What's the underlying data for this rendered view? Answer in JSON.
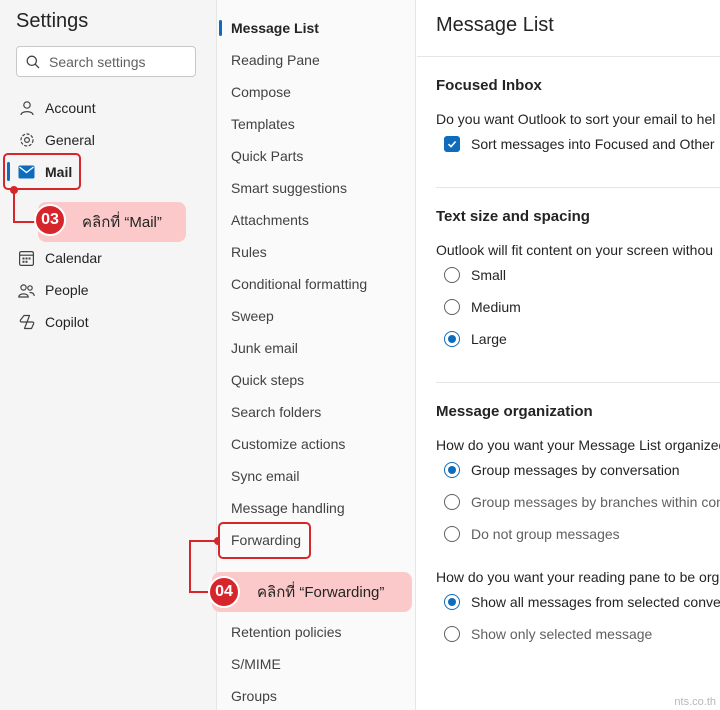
{
  "settings": {
    "title": "Settings",
    "search_placeholder": "Search settings",
    "items": [
      {
        "label": "Account",
        "icon": "person-icon"
      },
      {
        "label": "General",
        "icon": "gear-icon"
      },
      {
        "label": "Mail",
        "icon": "mail-icon",
        "active": true
      },
      {
        "label": "Calendar",
        "icon": "calendar-icon"
      },
      {
        "label": "People",
        "icon": "people-icon"
      },
      {
        "label": "Copilot",
        "icon": "copilot-icon"
      }
    ]
  },
  "mail_menu": {
    "selected": "Message List",
    "items": [
      "Message List",
      "Reading Pane",
      "Compose",
      "Templates",
      "Quick Parts",
      "Smart suggestions",
      "Attachments",
      "Rules",
      "Conditional formatting",
      "Sweep",
      "Junk email",
      "Quick steps",
      "Search folders",
      "Customize actions",
      "Sync email",
      "Message handling",
      "Forwarding",
      "",
      "Retention policies",
      "S/MIME",
      "Groups"
    ]
  },
  "content": {
    "title": "Message List",
    "focused_inbox": {
      "title": "Focused Inbox",
      "description": "Do you want Outlook to sort your email to hel",
      "checkbox_label": "Sort messages into Focused and Other",
      "checked": true
    },
    "text_size": {
      "title": "Text size and spacing",
      "description": "Outlook will fit content on your screen withou",
      "options": [
        "Small",
        "Medium",
        "Large"
      ],
      "selected": "Large"
    },
    "organization": {
      "title": "Message organization",
      "question1": "How do you want your Message List organized",
      "options1": [
        "Group messages by conversation",
        "Group messages by branches within con",
        "Do not group messages"
      ],
      "selected1": "Group messages by conversation",
      "question2": "How do you want your reading pane to be org",
      "options2": [
        "Show all messages from selected conver",
        "Show only selected message"
      ],
      "selected2": "Show all messages from selected conver"
    }
  },
  "annotations": {
    "step3_badge": "03",
    "step3_text": "คลิกที่ “Mail”",
    "step4_badge": "04",
    "step4_text": "คลิกที่ “Forwarding”",
    "color": "#d7262b"
  },
  "watermark": "nts.co.th",
  "colors": {
    "accent": "#0f6cbd",
    "annotation": "#d7262b",
    "callout_bg": "#fbc9c9"
  }
}
